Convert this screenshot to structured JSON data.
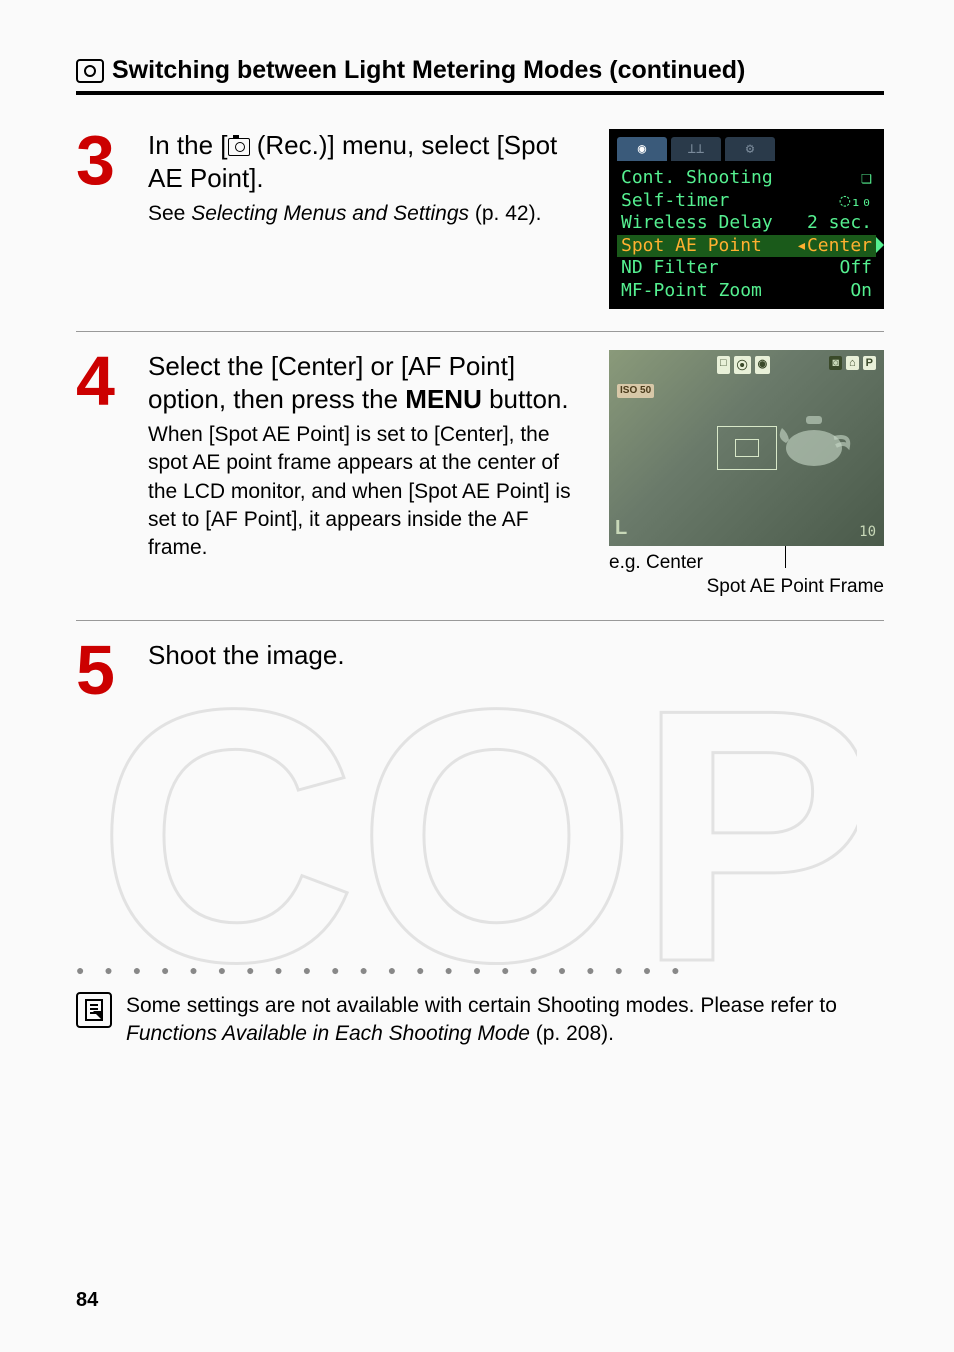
{
  "header": {
    "title": "Switching between Light Metering Modes (continued)"
  },
  "steps": [
    {
      "num": "3",
      "head_pre": "In the [",
      "head_mid": " (Rec.)] menu, select [Spot AE Point].",
      "body_pre": "See ",
      "body_italic": "Selecting Menus and Settings",
      "body_post": " (p. 42).",
      "shot": "menu"
    },
    {
      "num": "4",
      "head_a": "Select the [Center] or [AF Point] option, then press the ",
      "head_bold": "MENU",
      "head_b": " button.",
      "body": "When [Spot AE Point] is set to [Center], the spot AE point frame appears at the center of the LCD monitor, and when [Spot AE Point] is set to [AF Point], it appears inside the AF frame.",
      "caption": "e.g. Center",
      "caption_sub": "Spot AE Point Frame",
      "shot": "lcd"
    },
    {
      "num": "5",
      "head": "Shoot the image."
    }
  ],
  "menu_sim": {
    "lines": [
      {
        "l": "Cont. Shooting",
        "r": "❏"
      },
      {
        "l": "Self-timer",
        "r": "◌₁₀"
      },
      {
        "l": "Wireless Delay",
        "r": "2 sec."
      },
      {
        "l": "Spot AE Point",
        "r": "Center",
        "sel": true
      },
      {
        "l": "ND Filter",
        "r": "Off"
      },
      {
        "l": "MF-Point Zoom",
        "r": "On"
      }
    ]
  },
  "lcd_sim": {
    "iso": "ISO\n50",
    "L": "L",
    "count": "10",
    "top_left": [
      "□",
      "⦿",
      "◉"
    ],
    "top_right_dark": "◙",
    "top_right": [
      "⌂",
      "P"
    ]
  },
  "footnote": {
    "pre": "Some settings are not available with certain Shooting modes. Please refer to ",
    "italic": "Functions Available in Each Shooting Mode",
    "post": " (p. 208)."
  },
  "page_num": "84"
}
